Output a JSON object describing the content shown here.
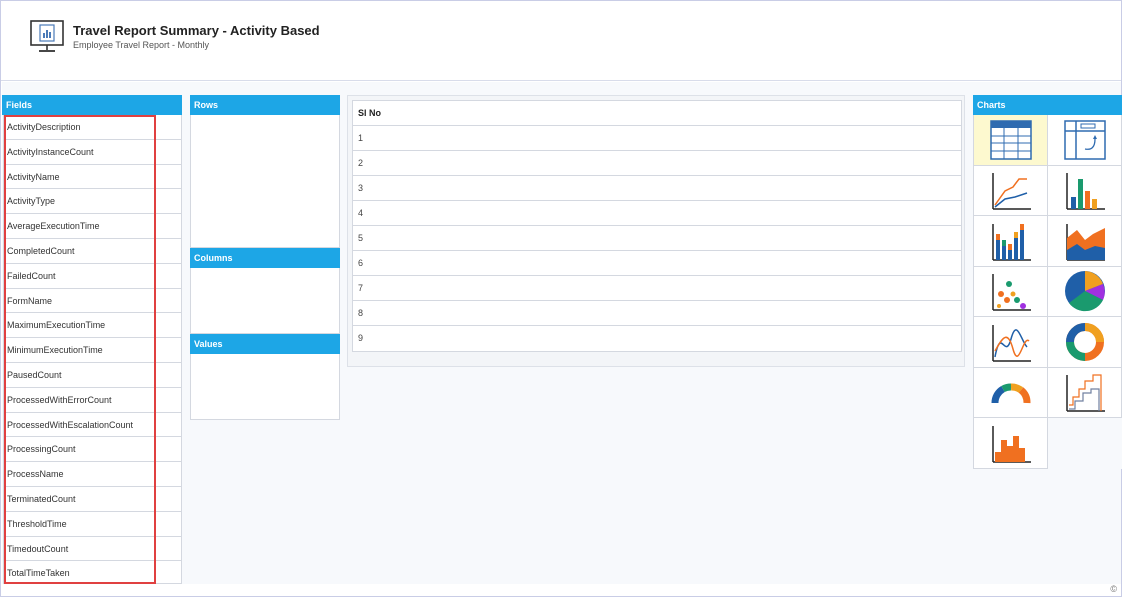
{
  "header": {
    "title": "Travel Report Summary - Activity Based",
    "subtitle": "Employee Travel Report - Monthly",
    "icon": "monitor-report-icon"
  },
  "panels": {
    "fields": "Fields",
    "rows": "Rows",
    "columns": "Columns",
    "values": "Values",
    "charts": "Charts"
  },
  "fields": [
    "ActivityDescription",
    "ActivityInstanceCount",
    "ActivityName",
    "ActivityType",
    "AverageExecutionTime",
    "CompletedCount",
    "FailedCount",
    "FormName",
    "MaximumExecutionTime",
    "MinimumExecutionTime",
    "PausedCount",
    "ProcessedWithErrorCount",
    "ProcessedWithEscalationCount",
    "ProcessingCount",
    "ProcessName",
    "TerminatedCount",
    "ThresholdTime",
    "TimedoutCount",
    "TotalTimeTaken"
  ],
  "grid": {
    "header": "Sl No",
    "rows": [
      "1",
      "2",
      "3",
      "4",
      "5",
      "6",
      "7",
      "8",
      "9"
    ]
  },
  "charts": [
    {
      "name": "table-chart-icon",
      "selected": true
    },
    {
      "name": "pivot-chart-icon",
      "selected": false
    },
    {
      "name": "line-chart-icon",
      "selected": false
    },
    {
      "name": "column-chart-icon",
      "selected": false
    },
    {
      "name": "stacked-column-chart-icon",
      "selected": false
    },
    {
      "name": "area-chart-icon",
      "selected": false
    },
    {
      "name": "scatter-chart-icon",
      "selected": false
    },
    {
      "name": "pie-chart-icon",
      "selected": false
    },
    {
      "name": "spline-chart-icon",
      "selected": false
    },
    {
      "name": "donut-chart-icon",
      "selected": false
    },
    {
      "name": "gauge-chart-icon",
      "selected": false
    },
    {
      "name": "step-line-chart-icon",
      "selected": false
    },
    {
      "name": "histogram-chart-icon",
      "selected": false
    }
  ],
  "footer": "©",
  "colors": {
    "panel_header": "#1da6e6",
    "selected_chart_bg": "#fdf9cf",
    "highlight_border": "#e04040"
  }
}
